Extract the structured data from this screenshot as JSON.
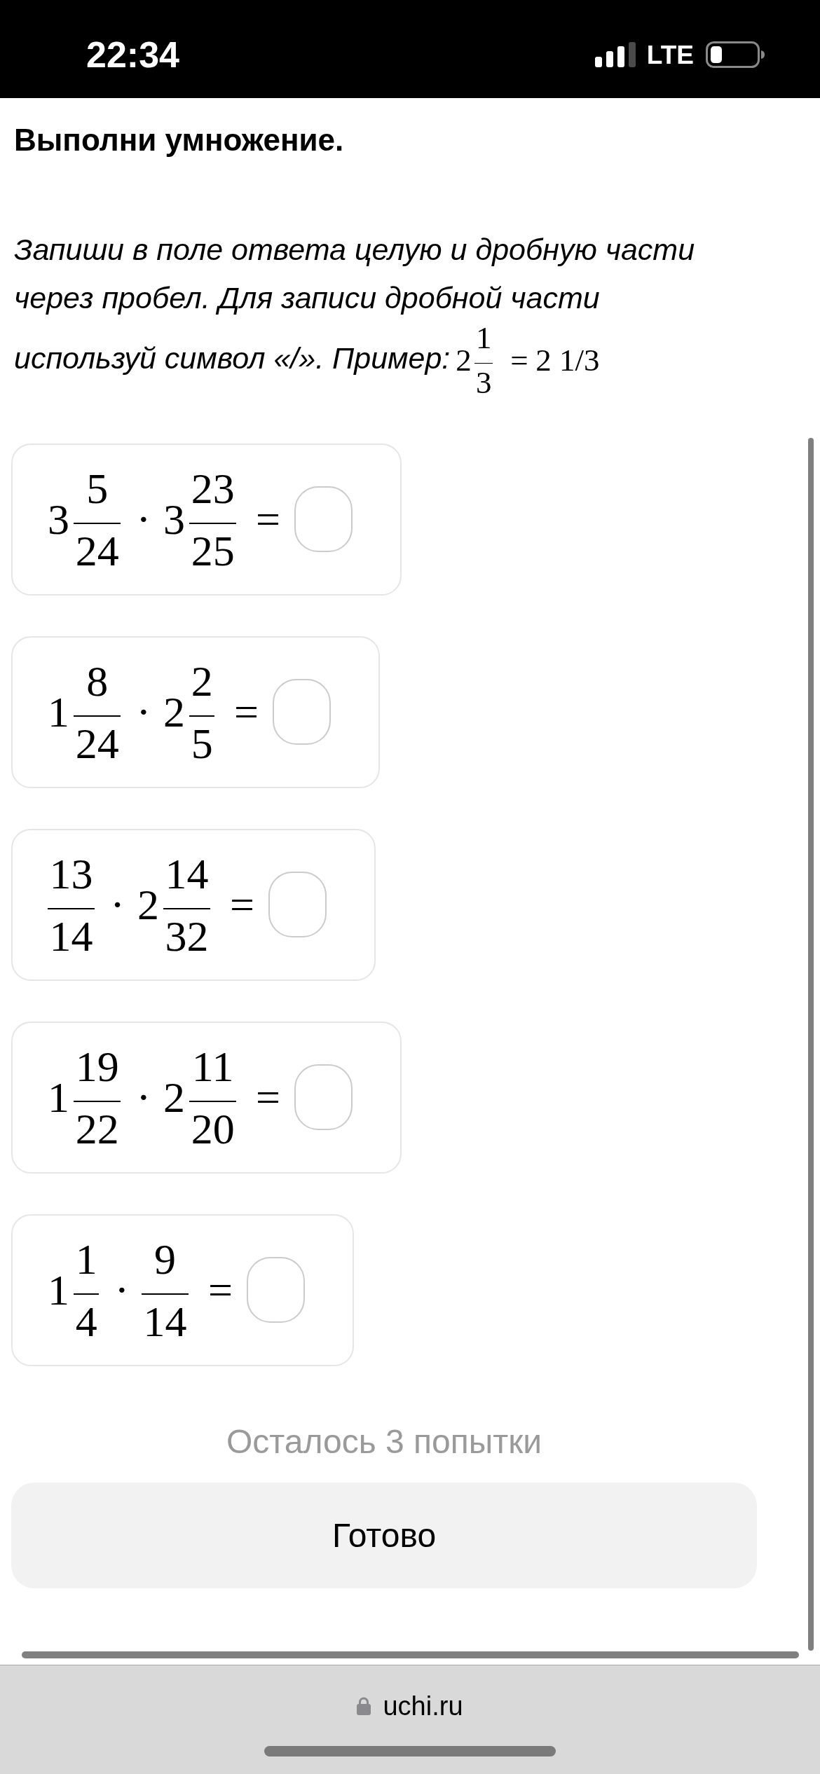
{
  "status_bar": {
    "time": "22:34",
    "network": "LTE"
  },
  "task": {
    "title": "Выполни умножение.",
    "instruction": "Запиши в поле ответа целую и дробную части через пробел. Для записи дробной части используй символ «/». Пример:",
    "example": {
      "left": {
        "kind": "mixed",
        "whole": "2",
        "num": "1",
        "den": "3"
      },
      "equals": "=",
      "result": "2 1/3"
    }
  },
  "problems": [
    {
      "left": {
        "kind": "mixed",
        "whole": "3",
        "num": "5",
        "den": "24"
      },
      "operator": "·",
      "right": {
        "kind": "mixed",
        "whole": "3",
        "num": "23",
        "den": "25"
      },
      "equals": "="
    },
    {
      "left": {
        "kind": "mixed",
        "whole": "1",
        "num": "8",
        "den": "24"
      },
      "operator": "·",
      "right": {
        "kind": "mixed",
        "whole": "2",
        "num": "2",
        "den": "5"
      },
      "equals": "="
    },
    {
      "left": {
        "kind": "fraction",
        "num": "13",
        "den": "14"
      },
      "operator": "·",
      "right": {
        "kind": "mixed",
        "whole": "2",
        "num": "14",
        "den": "32"
      },
      "equals": "="
    },
    {
      "left": {
        "kind": "mixed",
        "whole": "1",
        "num": "19",
        "den": "22"
      },
      "operator": "·",
      "right": {
        "kind": "mixed",
        "whole": "2",
        "num": "11",
        "den": "20"
      },
      "equals": "="
    },
    {
      "left": {
        "kind": "mixed",
        "whole": "1",
        "num": "1",
        "den": "4"
      },
      "operator": "·",
      "right": {
        "kind": "fraction",
        "num": "9",
        "den": "14"
      },
      "equals": "="
    }
  ],
  "attempts_left": "Осталось 3 попытки",
  "submit_button": {
    "label": "Готово"
  },
  "browser_bar": {
    "url": "uchi.ru"
  }
}
